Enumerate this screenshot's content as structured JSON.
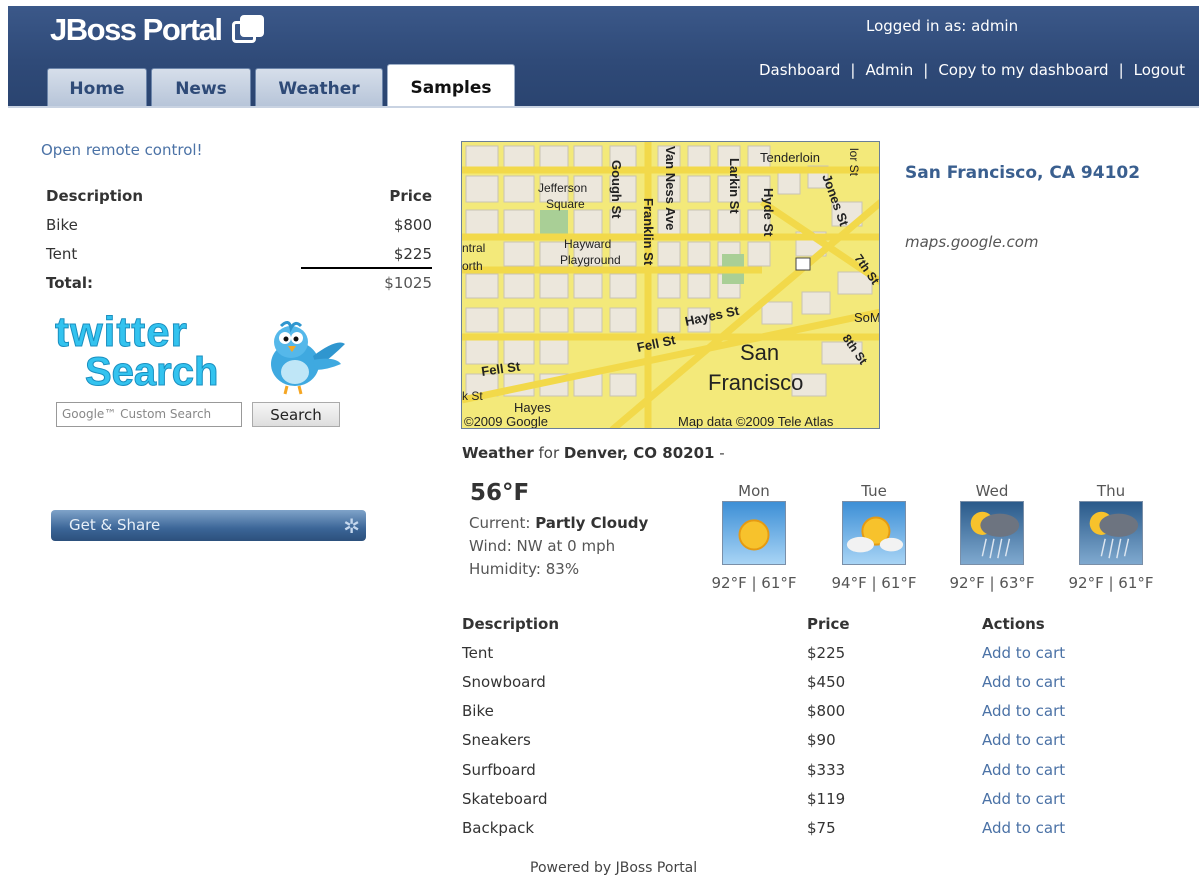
{
  "header": {
    "logo_text": "JBoss Portal",
    "logged_in": "Logged in as: admin",
    "links": [
      "Dashboard",
      "Admin",
      "Copy to my dashboard",
      "Logout"
    ],
    "tabs": [
      {
        "label": "Home"
      },
      {
        "label": "News"
      },
      {
        "label": "Weather"
      },
      {
        "label": "Samples"
      }
    ]
  },
  "left": {
    "remote_link": "Open remote control!",
    "cart": {
      "headers": [
        "Description",
        "Price"
      ],
      "items": [
        {
          "desc": "Bike",
          "price": "$800"
        },
        {
          "desc": "Tent",
          "price": "$225"
        }
      ],
      "total_label": "Total:",
      "total_value": "$1025"
    },
    "twitter": {
      "word1": "twitter",
      "word2": "Search"
    },
    "google": {
      "placeholder": "Google™ Custom Search",
      "button": "Search"
    },
    "share_label": "Get & Share"
  },
  "map": {
    "location": "San Francisco, CA 94102",
    "source": "maps.google.com",
    "labels": {
      "tenderloin": "Tenderloin",
      "jefferson": "Jefferson",
      "square": "Square",
      "hayward": "Hayward",
      "playground": "Playground",
      "ntral": "ntral",
      "orth": "orth",
      "gough": "Gough St",
      "vanness": "Van Ness Ave",
      "franklin": "Franklin St",
      "larkin": "Larkin St",
      "hyde": "Hyde St",
      "jones": "Jones St",
      "sev": "7th St",
      "eight": "8th St",
      "hayes": "Hayes St",
      "fell": "Fell St",
      "fell2": "Fell St",
      "som": "SoM",
      "san": "San",
      "francisco": "Francisco",
      "hayes2": "Hayes",
      "kst": "k St",
      "copyright": "©2009 Google",
      "mapdata": "Map data ©2009 Tele Atlas",
      "vors": "lor St"
    }
  },
  "weather": {
    "title_prefix": "Weather",
    "title_for": "for",
    "title_place": "Denver, CO 80201",
    "title_suffix": "-",
    "temp": "56°F",
    "current_label": "Current:",
    "current_value": "Partly Cloudy",
    "wind": "Wind: NW at 0 mph",
    "humidity": "Humidity: 83%",
    "days": [
      {
        "day": "Mon",
        "range": "92°F | 61°F",
        "icon": "sunny-icon"
      },
      {
        "day": "Tue",
        "range": "94°F | 61°F",
        "icon": "partly-cloudy-icon"
      },
      {
        "day": "Wed",
        "range": "92°F | 63°F",
        "icon": "rain-icon"
      },
      {
        "day": "Thu",
        "range": "92°F | 61°F",
        "icon": "rain-icon"
      }
    ]
  },
  "products": {
    "headers": [
      "Description",
      "Price",
      "Actions"
    ],
    "action_label": "Add to cart",
    "rows": [
      {
        "desc": "Tent",
        "price": "$225"
      },
      {
        "desc": "Snowboard",
        "price": "$450"
      },
      {
        "desc": "Bike",
        "price": "$800"
      },
      {
        "desc": "Sneakers",
        "price": "$90"
      },
      {
        "desc": "Surfboard",
        "price": "$333"
      },
      {
        "desc": "Skateboard",
        "price": "$119"
      },
      {
        "desc": "Backpack",
        "price": "$75"
      }
    ]
  },
  "footer": "Powered by JBoss Portal"
}
